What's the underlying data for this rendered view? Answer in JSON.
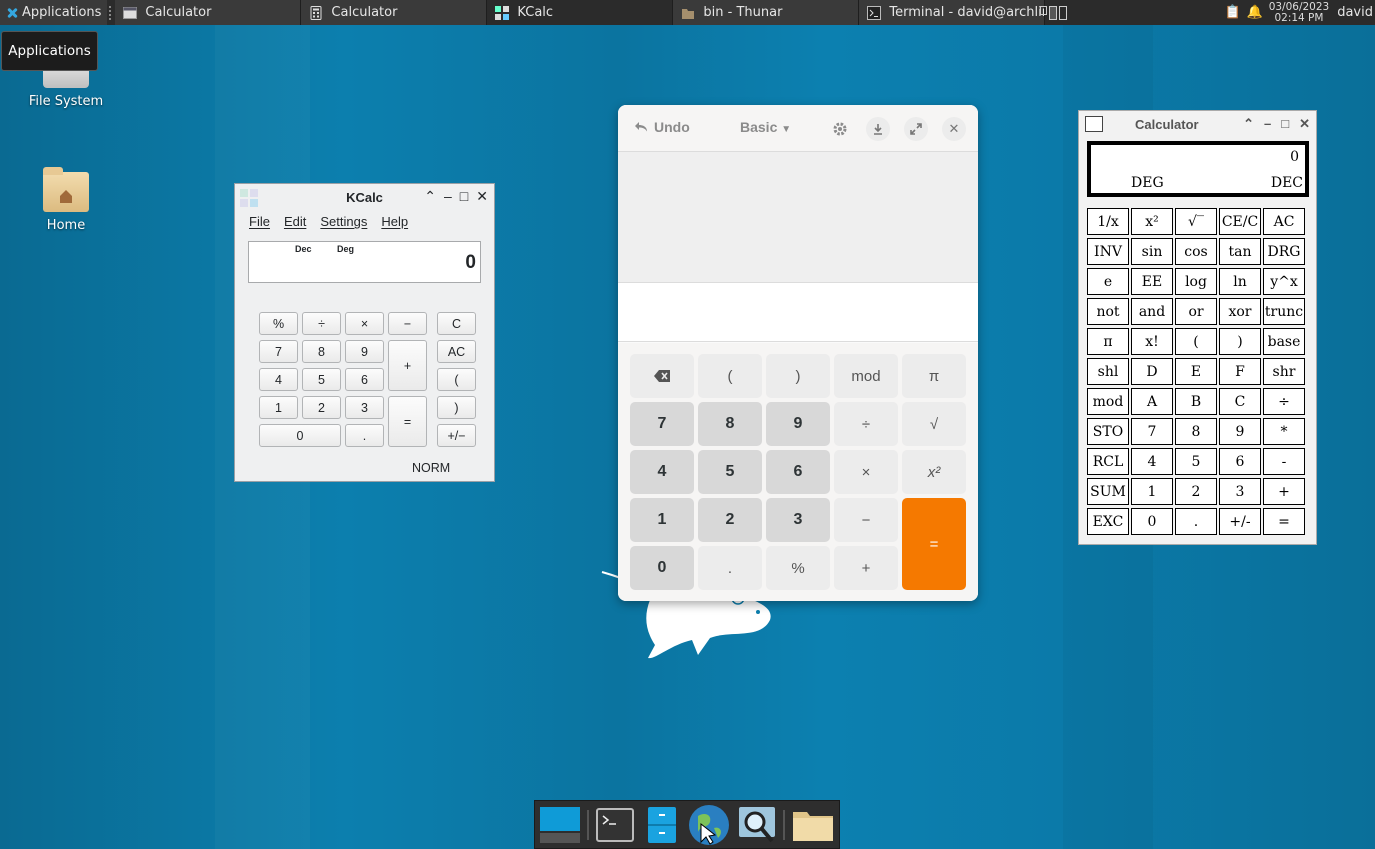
{
  "panel": {
    "applications_label": "Applications",
    "tasks": [
      {
        "label": "Calculator",
        "icon": "window-icon"
      },
      {
        "label": "Calculator",
        "icon": "calculator-icon"
      },
      {
        "label": "KCalc",
        "icon": "kcalc-icon"
      },
      {
        "label": "bin - Thunar",
        "icon": "folder-icon"
      },
      {
        "label": "Terminal - david@archlin...",
        "icon": "terminal-icon"
      }
    ],
    "date": "03/06/2023",
    "time": "02:14 PM",
    "user": "david"
  },
  "tooltip": "Applications",
  "desktop": {
    "icons": [
      {
        "label": "File System",
        "icon": "hard-drive-icon"
      },
      {
        "label": "Home",
        "icon": "home-folder-icon"
      }
    ]
  },
  "kcalc": {
    "title": "KCalc",
    "menu": [
      "File",
      "Edit",
      "Settings",
      "Help"
    ],
    "display": {
      "base": "Dec",
      "angle": "Deg",
      "value": "0"
    },
    "buttons": {
      "percent": "%",
      "div": "÷",
      "mul": "×",
      "minus": "−",
      "clear": "C",
      "seven": "7",
      "eight": "8",
      "nine": "9",
      "plus": "+",
      "allclear": "AC",
      "four": "4",
      "five": "5",
      "six": "6",
      "lparen": "(",
      "one": "1",
      "two": "2",
      "three": "3",
      "equals": "=",
      "rparen": ")",
      "zero": "0",
      "dot": ".",
      "sign": "+/−"
    },
    "status": "NORM"
  },
  "gnome_calc": {
    "undo_label": "Undo",
    "mode": "Basic",
    "keys": {
      "lparen": "(",
      "rparen": ")",
      "mod": "mod",
      "pi": "π",
      "seven": "7",
      "eight": "8",
      "nine": "9",
      "div": "÷",
      "sqrt": "√",
      "four": "4",
      "five": "5",
      "six": "6",
      "mul": "×",
      "square": "x²",
      "one": "1",
      "two": "2",
      "three": "3",
      "minus": "−",
      "equals": "=",
      "zero": "0",
      "dot": ".",
      "percent": "%",
      "plus": "+"
    },
    "accent": "#f57900"
  },
  "xcalc": {
    "title": "Calculator",
    "display": {
      "value": "0",
      "angle": "DEG",
      "base": "DEC"
    },
    "rows": [
      [
        "1/x",
        "x²",
        "√‾",
        "CE/C",
        "AC"
      ],
      [
        "INV",
        "sin",
        "cos",
        "tan",
        "DRG"
      ],
      [
        "e",
        "EE",
        "log",
        "ln",
        "y^x"
      ],
      [
        "not",
        "and",
        "or",
        "xor",
        "trunc"
      ],
      [
        "π",
        "x!",
        "(",
        ")",
        "base"
      ],
      [
        "shl",
        "D",
        "E",
        "F",
        "shr"
      ],
      [
        "mod",
        "A",
        "B",
        "C",
        "÷"
      ],
      [
        "STO",
        "7",
        "8",
        "9",
        "*"
      ],
      [
        "RCL",
        "4",
        "5",
        "6",
        "-"
      ],
      [
        "SUM",
        "1",
        "2",
        "3",
        "+"
      ],
      [
        "EXC",
        "0",
        ".",
        "+/-",
        "="
      ]
    ]
  },
  "dock": {
    "items": [
      "show-desktop-icon",
      "terminal-icon",
      "file-manager-icon",
      "web-browser-icon",
      "app-finder-icon",
      "folder-icon"
    ]
  }
}
